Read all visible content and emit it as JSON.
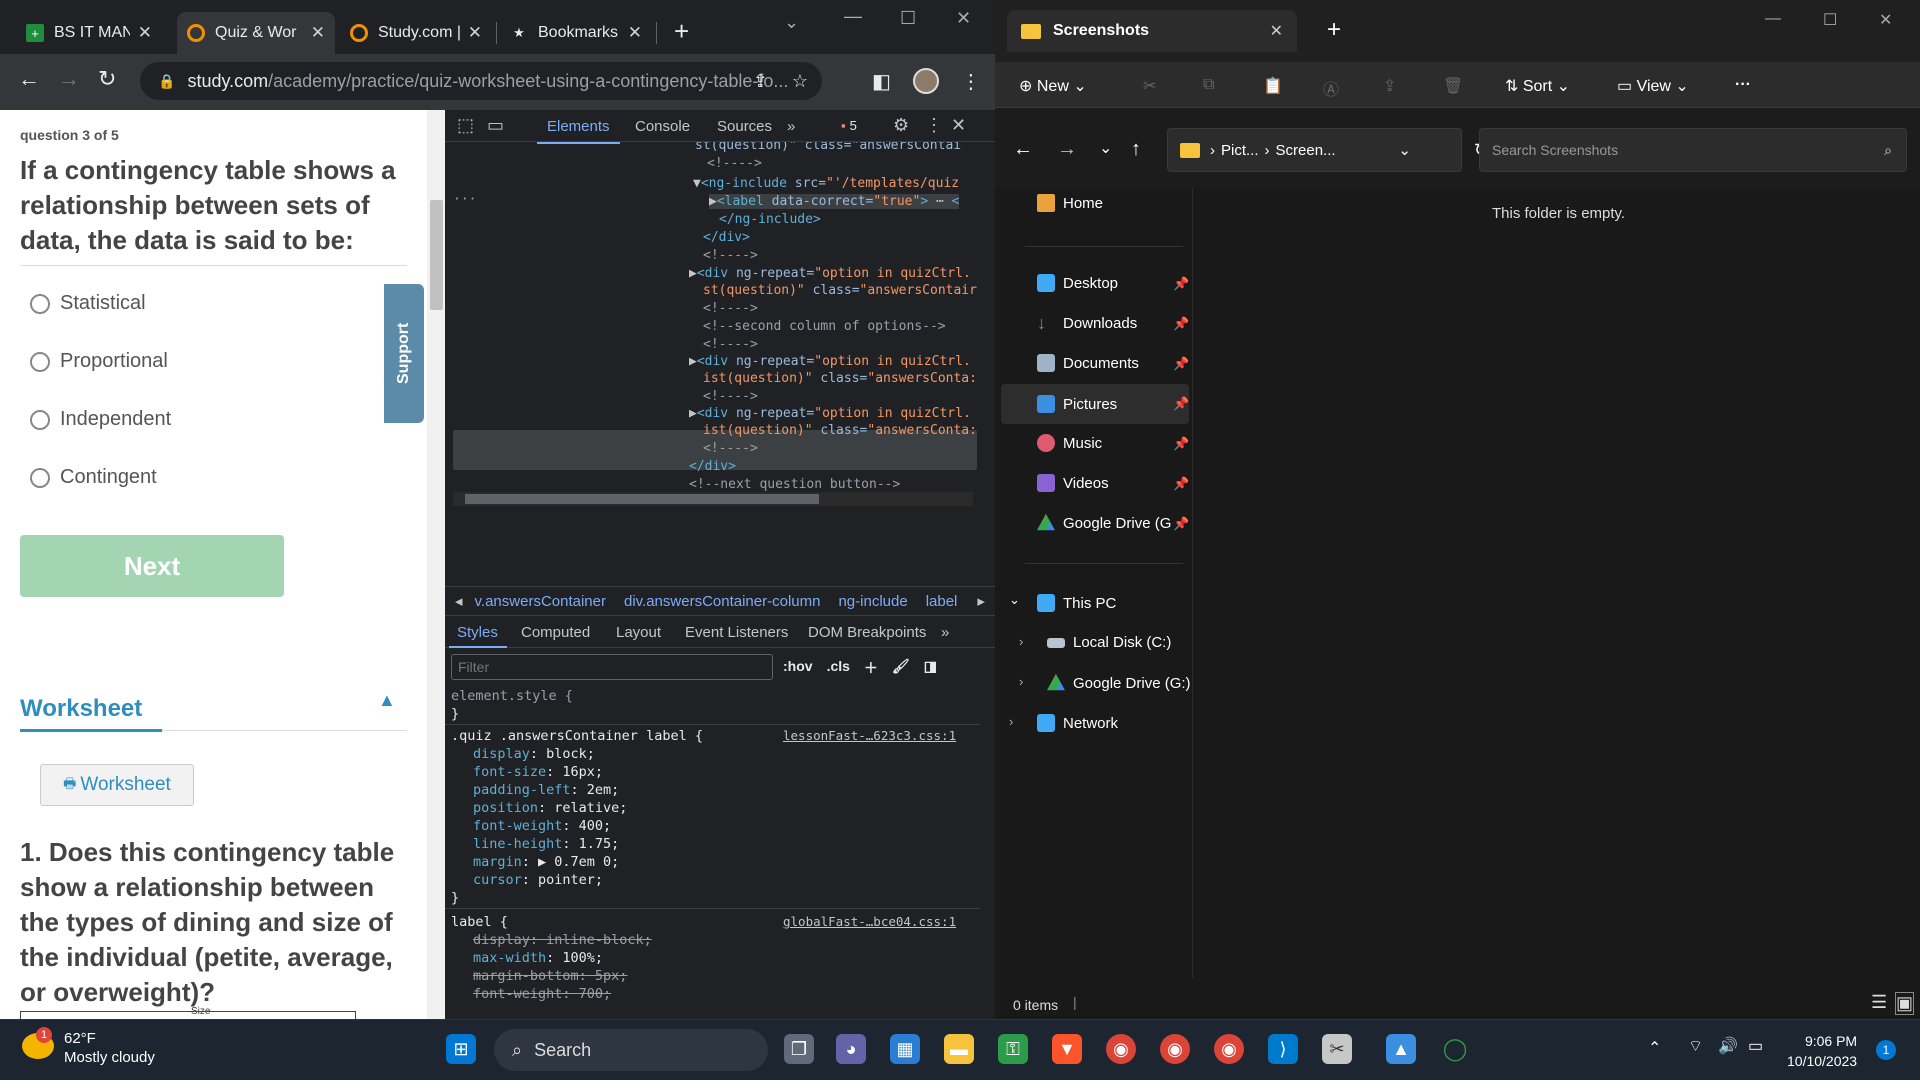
{
  "browser": {
    "tabs": [
      {
        "title": "BS IT MAN/"
      },
      {
        "title": "Quiz & Wor"
      },
      {
        "title": "Study.com |"
      },
      {
        "title": "Bookmarks"
      }
    ],
    "url_host": "study.com",
    "url_path": "/academy/practice/quiz-worksheet-using-a-contingency-table-fo..."
  },
  "quiz": {
    "question_number": "question 3 of 5",
    "question": "If a contingency table shows a relationship between sets of data, the data is said to be:",
    "options": [
      "Statistical",
      "Proportional",
      "Independent",
      "Contingent"
    ],
    "next_label": "Next",
    "support_label": "Support",
    "worksheet_heading": "Worksheet",
    "worksheet_button": "Worksheet",
    "worksheet_question": "1. Does this contingency table show a relationship between the types of dining and size of the individual (petite, average, or overweight)?",
    "table_stub": "Size"
  },
  "devtools": {
    "tabs": [
      "Elements",
      "Console",
      "Sources"
    ],
    "issues_count": "5",
    "breadcrumbs": [
      "v.answersContainer",
      "div.answersContainer-column",
      "ng-include",
      "label"
    ],
    "style_tabs": [
      "Styles",
      "Computed",
      "Layout",
      "Event Listeners",
      "DOM Breakpoints"
    ],
    "filter_placeholder": "Filter",
    "hov": ":hov",
    "cls": ".cls",
    "rule1_source": "lessonFast-…623c3.css:1",
    "rule2_source": "globalFast-…bce04.css:1"
  },
  "explorer": {
    "tab_title": "Screenshots",
    "new_label": "New",
    "sort_label": "Sort",
    "view_label": "View",
    "address": [
      "Pict...",
      "Screen..."
    ],
    "search_placeholder": "Search Screenshots",
    "empty_text": "This folder is empty.",
    "status": "0 items",
    "sidebar": {
      "home": "Home",
      "quick": [
        "Desktop",
        "Downloads",
        "Documents",
        "Pictures",
        "Music",
        "Videos",
        "Google Drive (G"
      ],
      "this_pc": "This PC",
      "drives": [
        "Local Disk (C:)",
        "Google Drive (G:)"
      ],
      "network": "Network"
    }
  },
  "taskbar": {
    "temperature": "62°F",
    "weather": "Mostly cloudy",
    "weather_badge": "1",
    "search_label": "Search",
    "time": "9:06 PM",
    "date": "10/10/2023",
    "notification_count": "1"
  },
  "colors": {
    "next_button": "#a3d5b3",
    "worksheet_accent": "#2f8dbf",
    "support_tab": "#5b8ba8",
    "devtools_accent": "#7cacf8"
  }
}
